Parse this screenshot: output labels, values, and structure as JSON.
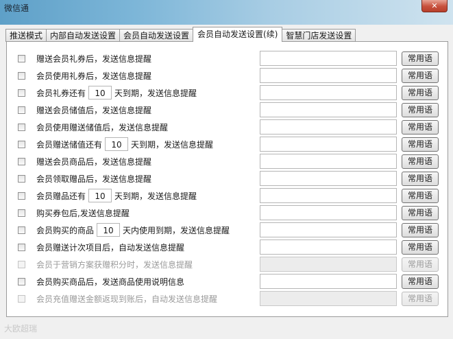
{
  "window": {
    "title": "微信通"
  },
  "tabs": [
    {
      "label": "推送模式",
      "active": false
    },
    {
      "label": "内部自动发送设置",
      "active": false
    },
    {
      "label": "会员自动发送设置",
      "active": false
    },
    {
      "label": "会员自动发送设置(续)",
      "active": true
    },
    {
      "label": "智慧门店发送设置",
      "active": false
    }
  ],
  "common_button_label": "常用语",
  "rows": [
    {
      "text": "赠送会员礼券后，发送信息提醒",
      "enabled": true
    },
    {
      "text": "会员使用礼券后，发送信息提醒",
      "enabled": true
    },
    {
      "prefix": "会员礼券还有",
      "days": "10",
      "suffix": "天到期，发送信息提醒",
      "enabled": true
    },
    {
      "text": "赠送会员储值后，发送信息提醒",
      "enabled": true
    },
    {
      "text": "会员使用赠送储值后，发送信息提醒",
      "enabled": true
    },
    {
      "prefix": "会员赠送储值还有",
      "days": "10",
      "suffix": "天到期，发送信息提醒",
      "enabled": true
    },
    {
      "text": "赠送会员商品后，发送信息提醒",
      "enabled": true
    },
    {
      "text": "会员领取赠品后，发送信息提醒",
      "enabled": true
    },
    {
      "prefix": "会员赠品还有",
      "days": "10",
      "suffix": "天到期，发送信息提醒",
      "enabled": true
    },
    {
      "text": "购买券包后,发送信息提醒",
      "enabled": true
    },
    {
      "prefix": "会员购买的商品",
      "days": "10",
      "suffix": "天内使用到期，发送信息提醒",
      "enabled": true
    },
    {
      "text": "会员赠送计次项目后，自动发送信息提醒",
      "enabled": true
    },
    {
      "text": "会员于营销方案获赠积分时，发送信息提醒",
      "enabled": false
    },
    {
      "text": "会员购买商品后，发送商品使用说明信息",
      "enabled": true
    },
    {
      "text": "会员充值赠送金额返现到账后，自动发送信息提醒",
      "enabled": false
    }
  ],
  "watermark": "大欧超瑞"
}
